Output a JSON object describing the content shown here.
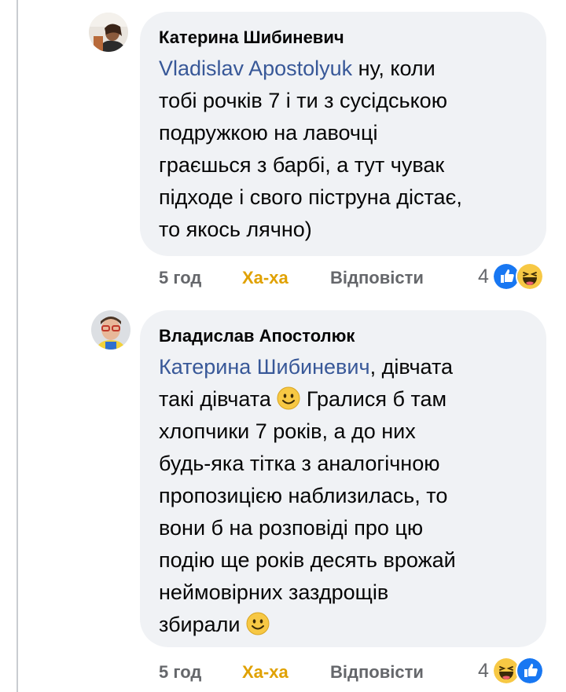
{
  "comments": [
    {
      "author": "Катерина Шибиневич",
      "mention": "Vladislav Apostolyuk",
      "text_lines": [
        " ну, коли",
        "тобі рочків 7 і ти з сусідською",
        "подружкою на лавочці",
        "граєшься з барбі, а тут чувак",
        "підходе і свого піструна дістає,",
        "то якось лячно)"
      ],
      "time": "5 год",
      "haha_label": "Ха-ха",
      "reply_label": "Відповісти",
      "reaction_count": "4",
      "reactions": [
        "like-icon",
        "haha-icon"
      ]
    },
    {
      "author": "Владислав Апостолюк",
      "mention": "Катерина Шибиневич",
      "text_lines": [
        ", дівчата",
        "такі дівчата",
        "хлопчики 7 років, а до них",
        "будь-яка тітка з аналогічною",
        "пропозицією наблизилась, то",
        "вони б на розповіді про цю",
        "подію ще років десять врожай",
        "неймовірних заздрощів",
        "збирали"
      ],
      "line2_after_emoji": " Гралися б там",
      "time": "5 год",
      "haha_label": "Ха-ха",
      "reply_label": "Відповісти",
      "reaction_count": "4",
      "reactions": [
        "haha-icon",
        "like-icon"
      ]
    }
  ],
  "colors": {
    "bubble": "#f0f2f5",
    "mention": "#385898",
    "haha": "#e0a100",
    "meta": "#65676b",
    "like": "#1877f2"
  }
}
